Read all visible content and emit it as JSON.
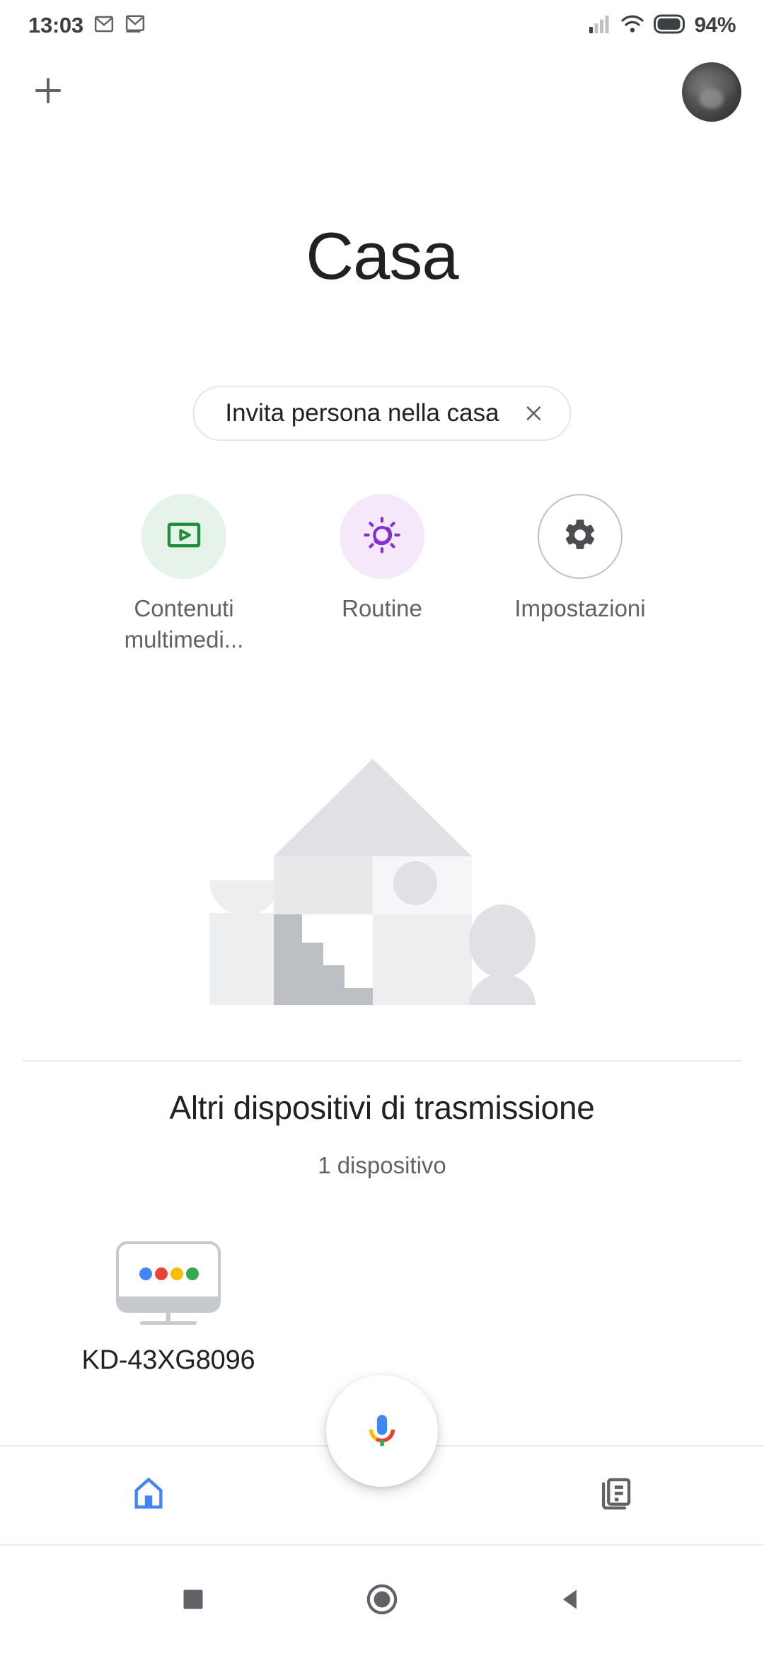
{
  "status_bar": {
    "time": "13:03",
    "battery_percent": "94%",
    "icons": [
      "gmail-icon",
      "gmail-icon",
      "signal-icon",
      "wifi-icon",
      "battery-icon"
    ]
  },
  "app_bar": {
    "add_label": "+",
    "add_icon": "plus-icon",
    "avatar_icon": "account-avatar"
  },
  "header": {
    "title": "Casa"
  },
  "invite_chip": {
    "label": "Invita persona nella casa",
    "close_icon": "close-icon"
  },
  "quick_actions": [
    {
      "label": "Contenuti multimedi...",
      "icon": "media-play-icon",
      "bg": "#e5f3e8",
      "fg": "#1e8e3e"
    },
    {
      "label": "Routine",
      "icon": "routine-sun-moon-icon",
      "bg": "#f5e8fb",
      "fg": "#8430ce"
    },
    {
      "label": "Impostazioni",
      "icon": "gear-icon",
      "bg": "#ffffff",
      "fg": "#5f6368"
    }
  ],
  "illustration": {
    "name": "empty-home-illustration"
  },
  "cast_section": {
    "title": "Altri dispositivi di trasmissione",
    "subtitle": "1 dispositivo",
    "devices": [
      {
        "name": "KD-43XG8096",
        "icon": "tv-cast-icon"
      }
    ]
  },
  "mic_fab": {
    "icon": "google-assistant-mic-icon"
  },
  "bottom_nav": [
    {
      "name": "home",
      "icon": "home-icon",
      "active": true,
      "color": "#4285f4"
    },
    {
      "name": "feed",
      "icon": "feed-icon",
      "active": false,
      "color": "#5f6368"
    }
  ],
  "android_nav": [
    {
      "name": "recents",
      "icon": "square-icon"
    },
    {
      "name": "home",
      "icon": "circle-icon"
    },
    {
      "name": "back",
      "icon": "triangle-back-icon"
    }
  ],
  "colors": {
    "accent_blue": "#4285f4",
    "google_red": "#ea4335",
    "google_yellow": "#fbbc04",
    "google_green": "#34a853",
    "text_primary": "#202124",
    "text_secondary": "#5f6368"
  }
}
